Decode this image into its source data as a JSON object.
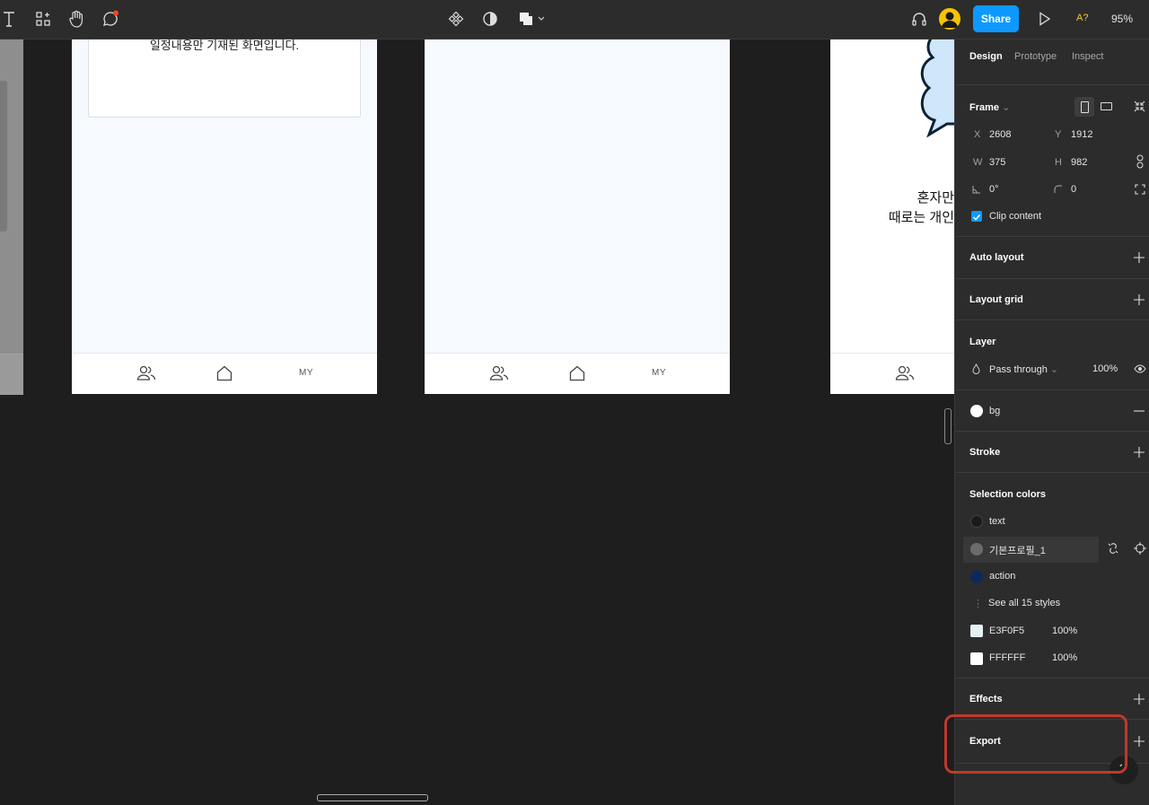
{
  "toolbar": {
    "share_label": "Share",
    "zoom": "95%",
    "ab_label": "A?"
  },
  "canvas": {
    "frame1": {
      "schedule_text": "일정내용만 기재된 화면입니다.",
      "tab_my": "MY"
    },
    "frame2": {
      "tab_my": "MY"
    },
    "frame3": {
      "speech_line1": "혼자만",
      "speech_line2": "때로는 개인"
    }
  },
  "panel": {
    "tabs": [
      "Design",
      "Prototype",
      "Inspect"
    ],
    "frame": {
      "title": "Frame",
      "x_label": "X",
      "x": "2608",
      "y_label": "Y",
      "y": "1912",
      "w_label": "W",
      "w": "375",
      "h_label": "H",
      "h": "982",
      "rotation": "0°",
      "radius": "0",
      "clip_content": "Clip content"
    },
    "auto_layout": "Auto layout",
    "layout_grid": "Layout grid",
    "layer": {
      "title": "Layer",
      "blend": "Pass through",
      "opacity": "100%"
    },
    "fill": {
      "name": "bg"
    },
    "stroke": "Stroke",
    "selection_colors": {
      "title": "Selection colors",
      "styles": [
        {
          "name": "text",
          "color": "#1a1a1a"
        },
        {
          "name": "기본프로필_1",
          "color": "#6b6b6b"
        },
        {
          "name": "action",
          "color": "#0b2a5a"
        }
      ],
      "see_all": "See all 15 styles",
      "raw": [
        {
          "hex": "E3F0F5",
          "opacity": "100%",
          "color": "#E3F0F5"
        },
        {
          "hex": "FFFFFF",
          "opacity": "100%",
          "color": "#FFFFFF"
        }
      ]
    },
    "effects": "Effects",
    "export": "Export"
  },
  "colors": {
    "accent": "#0d99ff",
    "highlight": "#c0392b",
    "panel_bg": "#2c2c2c",
    "canvas_bg": "#1e1e1e"
  }
}
